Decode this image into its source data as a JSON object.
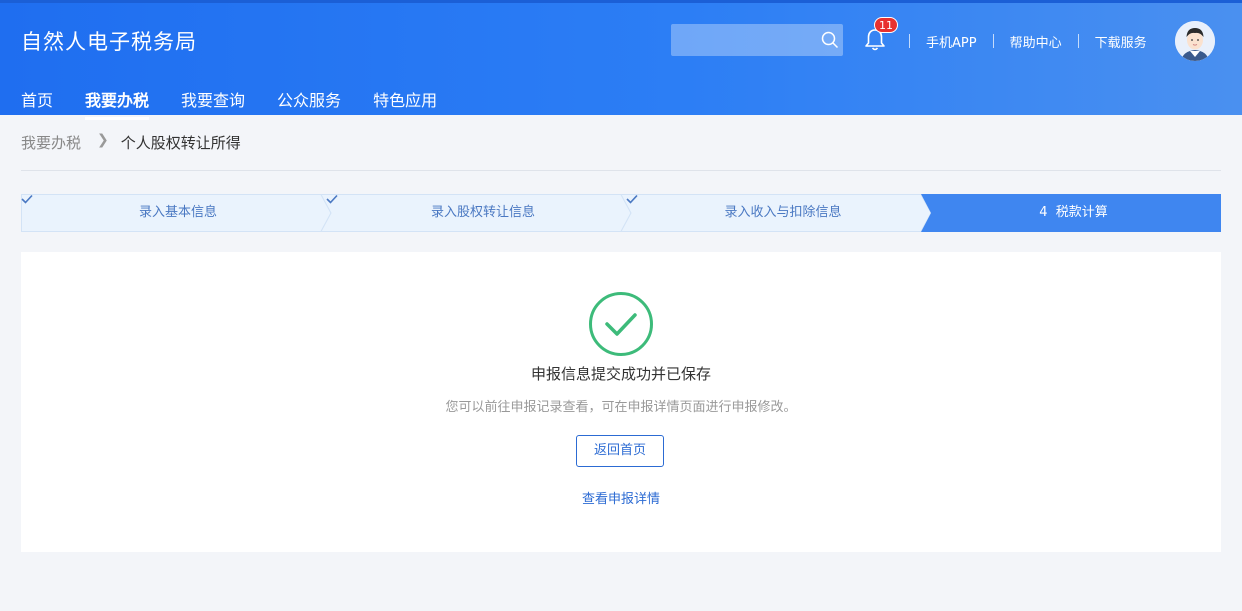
{
  "header": {
    "logo": "自然人电子税务局",
    "search": {
      "placeholder": ""
    },
    "notification_count": "11",
    "links": [
      "手机APP",
      "帮助中心",
      "下载服务"
    ]
  },
  "nav": {
    "items": [
      {
        "label": "首页",
        "active": false
      },
      {
        "label": "我要办税",
        "active": true
      },
      {
        "label": "我要查询",
        "active": false
      },
      {
        "label": "公众服务",
        "active": false
      },
      {
        "label": "特色应用",
        "active": false
      }
    ]
  },
  "breadcrumb": {
    "home": "我要办税",
    "current": "个人股权转让所得"
  },
  "steps": [
    {
      "label": "录入基本信息",
      "status": "done"
    },
    {
      "label": "录入股权转让信息",
      "status": "done"
    },
    {
      "label": "录入收入与扣除信息",
      "status": "done"
    },
    {
      "number": "4",
      "label": "税款计算",
      "status": "current"
    }
  ],
  "result": {
    "title": "申报信息提交成功并已保存",
    "subtitle": "您可以前往申报记录查看，可在申报详情页面进行申报修改。",
    "home_button": "返回首页",
    "detail_link": "查看申报详情"
  },
  "colors": {
    "brand": "#1f6ef0",
    "success": "#3dbb7a",
    "link": "#2c6bd3",
    "step_current": "#3f86f0",
    "step_done": "#eaf3fd"
  },
  "icons": [
    "search-icon",
    "bell-icon",
    "avatar",
    "check-icon",
    "chevron-right-icon",
    "success-check-icon"
  ]
}
